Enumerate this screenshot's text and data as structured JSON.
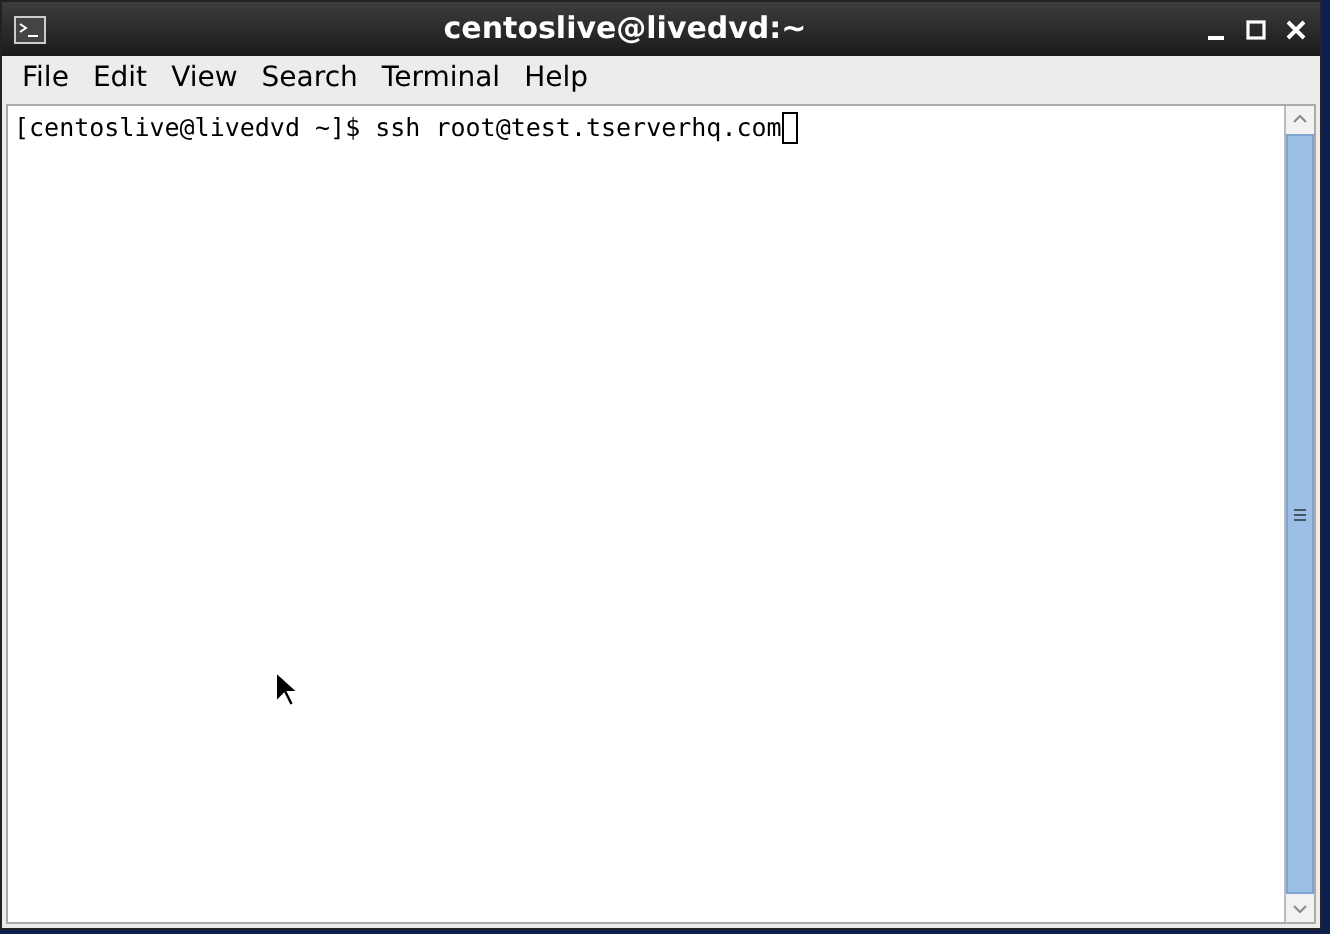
{
  "window": {
    "title": "centoslive@livedvd:~"
  },
  "menu": [
    {
      "label": "File"
    },
    {
      "label": "Edit"
    },
    {
      "label": "View"
    },
    {
      "label": "Search"
    },
    {
      "label": "Terminal"
    },
    {
      "label": "Help"
    }
  ],
  "terminal": {
    "lines": [
      {
        "prompt": "[centoslive@livedvd ~]$ ",
        "command": "ssh root@test.tserverhq.com"
      }
    ]
  }
}
